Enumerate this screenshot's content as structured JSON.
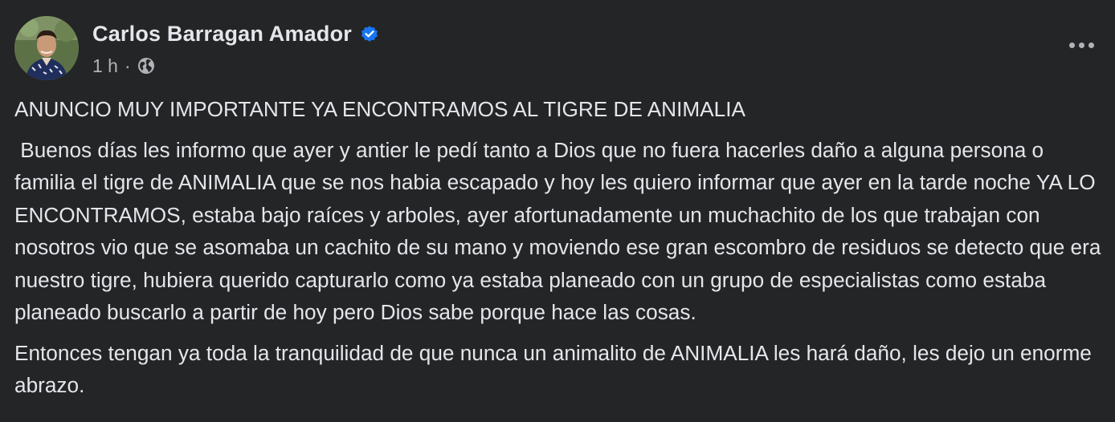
{
  "post": {
    "author": "Carlos Barragan Amador",
    "verified_icon": "verified-badge-icon",
    "time": "1 h",
    "separator": "·",
    "audience_icon": "globe-icon",
    "more_icon": "more-options-icon",
    "paragraphs": [
      "ANUNCIO MUY IMPORTANTE YA ENCONTRAMOS AL TIGRE DE ANIMALIA",
      " Buenos días les informo que ayer y antier le pedí tanto a Dios que no fuera hacerles daño a alguna persona o familia el tigre de ANIMALIA que se nos habia escapado y hoy les quiero informar que ayer en la tarde noche YA LO ENCONTRAMOS, estaba bajo raíces y arboles, ayer afortunadamente un muchachito de los que trabajan con nosotros vio que se asomaba un cachito de su mano y moviendo ese gran escombro de residuos se detecto que era nuestro tigre, hubiera querido capturarlo como ya estaba planeado con un grupo de especialistas como estaba planeado buscarlo a partir de hoy pero Dios sabe porque hace las cosas.",
      "Entonces tengan ya toda la tranquilidad de que nunca un animalito de ANIMALIA les hará daño, les dejo un enorme abrazo."
    ]
  },
  "colors": {
    "background": "#242526",
    "primary_text": "#e4e6eb",
    "secondary_text": "#b0b3b8",
    "verified_blue": "#1877f2"
  }
}
